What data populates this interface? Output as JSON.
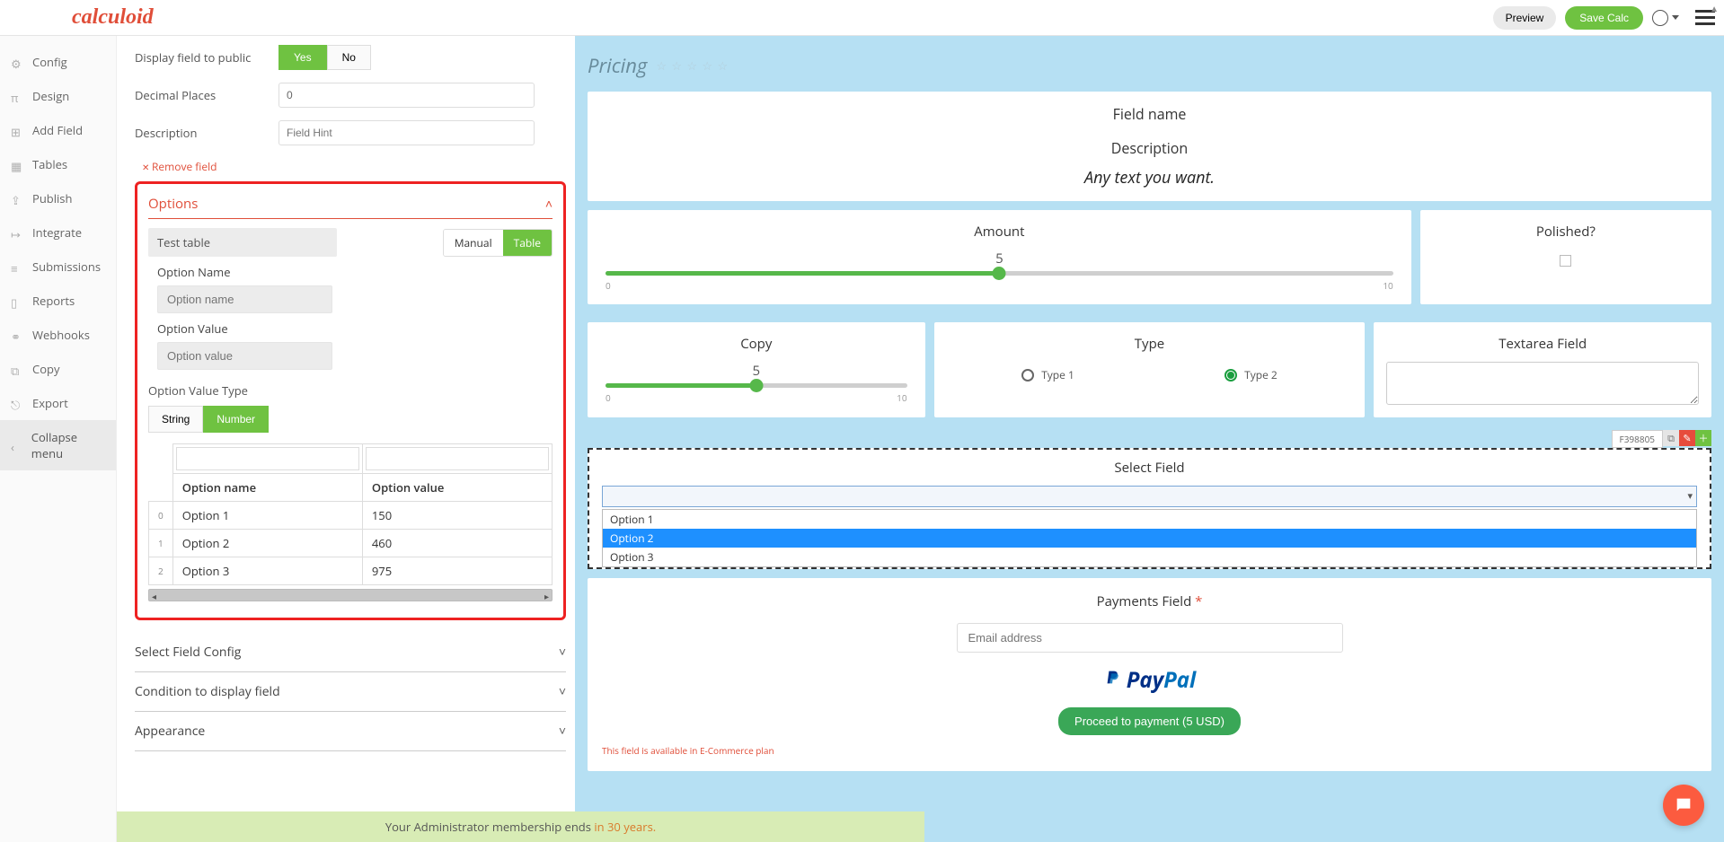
{
  "logo": "calculoid",
  "topbar": {
    "preview": "Preview",
    "save": "Save Calc"
  },
  "sidebar": {
    "items": [
      {
        "label": "Config"
      },
      {
        "label": "Design"
      },
      {
        "label": "Add Field"
      },
      {
        "label": "Tables"
      },
      {
        "label": "Publish"
      },
      {
        "label": "Integrate"
      },
      {
        "label": "Submissions"
      },
      {
        "label": "Reports"
      },
      {
        "label": "Webhooks"
      },
      {
        "label": "Copy"
      },
      {
        "label": "Export"
      }
    ],
    "collapse": "Collapse menu"
  },
  "form": {
    "display_label": "Display field to public",
    "yes": "Yes",
    "no": "No",
    "decimal_label": "Decimal Places",
    "decimal_value": "0",
    "desc_label": "Description",
    "desc_placeholder": "Field Hint",
    "remove": "Remove field"
  },
  "options": {
    "title": "Options",
    "table_name": "Test table",
    "mode_manual": "Manual",
    "mode_table": "Table",
    "opt_name_label": "Option Name",
    "opt_name_ph": "Option name",
    "opt_value_label": "Option Value",
    "opt_value_ph": "Option value",
    "ovt_label": "Option Value Type",
    "ovt_string": "String",
    "ovt_number": "Number",
    "col_name": "Option name",
    "col_value": "Option value",
    "rows": [
      {
        "idx": "0",
        "name": "Option 1",
        "value": "150"
      },
      {
        "idx": "1",
        "name": "Option 2",
        "value": "460"
      },
      {
        "idx": "2",
        "name": "Option 3",
        "value": "975"
      }
    ]
  },
  "collapsibles": {
    "a": "Select Field Config",
    "b": "Condition to display field",
    "c": "Appearance"
  },
  "footer": {
    "text": "Your Administrator membership ends ",
    "years": "in 30 years."
  },
  "preview": {
    "title": "Pricing",
    "top": {
      "field_name": "Field name",
      "description": "Description",
      "any_text": "Any text you want."
    },
    "amount": {
      "title": "Amount",
      "value": "5",
      "min": "0",
      "max": "10"
    },
    "polished": {
      "title": "Polished?"
    },
    "copy": {
      "title": "Copy",
      "value": "5",
      "min": "0",
      "max": "10"
    },
    "type": {
      "title": "Type",
      "opt1": "Type 1",
      "opt2": "Type 2"
    },
    "textarea": {
      "title": "Textarea Field"
    },
    "field_id": "F398805",
    "select": {
      "title": "Select Field",
      "options": [
        "Option 1",
        "Option 2",
        "Option 3"
      ]
    },
    "payments": {
      "title": "Payments Field",
      "email_ph": "Email address",
      "pp1": "Pay",
      "pp2": "Pal",
      "proceed": "Proceed to payment (5 USD)",
      "note": "This field is available in E-Commerce plan"
    }
  }
}
